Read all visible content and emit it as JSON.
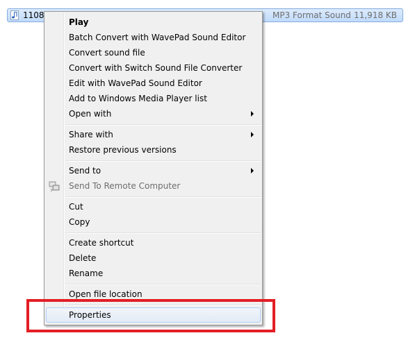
{
  "file": {
    "name": "1108_S",
    "type": "MP3 Format Sound",
    "size": "11,918 KB"
  },
  "menu": {
    "items": [
      {
        "label": "Play"
      },
      {
        "label": "Batch Convert with WavePad Sound Editor"
      },
      {
        "label": "Convert sound file"
      },
      {
        "label": "Convert with Switch Sound File Converter"
      },
      {
        "label": "Edit with WavePad Sound Editor"
      },
      {
        "label": "Add to Windows Media Player list"
      },
      {
        "label": "Open with"
      },
      {
        "label": "Share with"
      },
      {
        "label": "Restore previous versions"
      },
      {
        "label": "Send to"
      },
      {
        "label": "Send To Remote Computer"
      },
      {
        "label": "Cut"
      },
      {
        "label": "Copy"
      },
      {
        "label": "Create shortcut"
      },
      {
        "label": "Delete"
      },
      {
        "label": "Rename"
      },
      {
        "label": "Open file location"
      },
      {
        "label": "Properties"
      }
    ]
  },
  "annotation": {
    "color": "#e31e24"
  }
}
